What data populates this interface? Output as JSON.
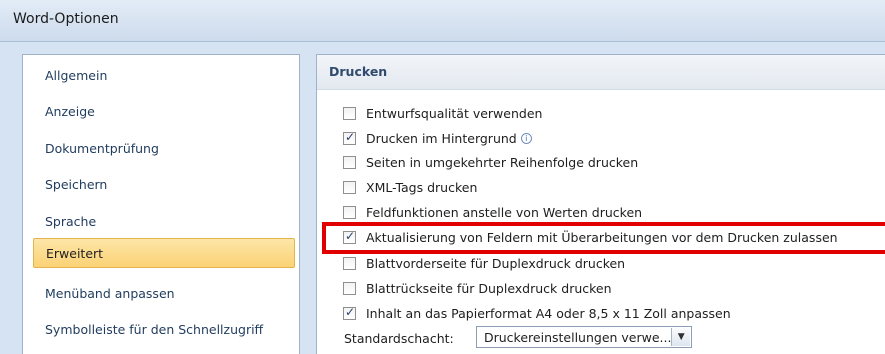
{
  "window": {
    "title": "Word-Optionen"
  },
  "sidebar": {
    "items": [
      {
        "label": "Allgemein"
      },
      {
        "label": "Anzeige"
      },
      {
        "label": "Dokumentprüfung"
      },
      {
        "label": "Speichern"
      },
      {
        "label": "Sprache"
      },
      {
        "label": "Erweitert",
        "selected": true
      },
      {
        "label": "Menüband anpassen"
      },
      {
        "label": "Symbolleiste für den Schnellzugriff"
      }
    ]
  },
  "section": {
    "title": "Drucken",
    "options": [
      {
        "label": "Entwurfsqualität verwenden",
        "checked": false
      },
      {
        "label": "Drucken im Hintergrund",
        "checked": true,
        "icon": "info-icon"
      },
      {
        "label": "Seiten in umgekehrter Reihenfolge drucken",
        "checked": false
      },
      {
        "label": "XML-Tags drucken",
        "checked": false
      },
      {
        "label": "Feldfunktionen anstelle von Werten drucken",
        "checked": false
      },
      {
        "label": "Aktualisierung von Feldern mit Überarbeitungen vor dem Drucken zulassen",
        "checked": true,
        "highlighted": true
      },
      {
        "label": "Blattvorderseite für Duplexdruck drucken",
        "checked": false
      },
      {
        "label": "Blattrückseite für Duplexdruck drucken",
        "checked": false
      },
      {
        "label": "Inhalt an das Papierformat A4 oder 8,5 x 11 Zoll anpassen",
        "checked": true
      }
    ],
    "tray": {
      "label": "Standardschacht:",
      "value": "Druckereinstellungen verwe..."
    }
  },
  "colors": {
    "highlight": "#e00000",
    "selected_nav": "#fbd275",
    "header_text": "#2f4a6d"
  }
}
